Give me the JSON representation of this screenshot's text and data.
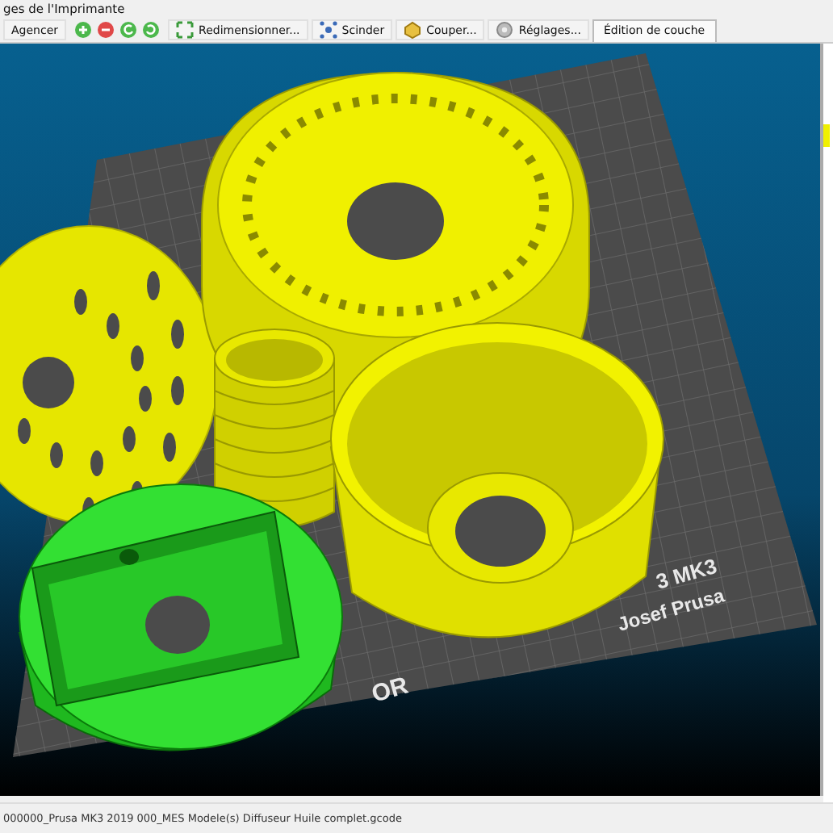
{
  "window": {
    "title": "ges de l'Imprimante"
  },
  "toolbar": {
    "buttons": [
      {
        "label": "Agencer",
        "kind": "plain"
      },
      {
        "label": "Redimensionner...",
        "kind": "scale"
      },
      {
        "label": "Scinder",
        "kind": "split"
      },
      {
        "label": "Couper...",
        "kind": "cut"
      },
      {
        "label": "Réglages...",
        "kind": "settings"
      }
    ],
    "tab": {
      "label": "Édition de couche"
    }
  },
  "viewport": {
    "bed_labels": [
      "3 MK3",
      "Josef Prusa",
      "OR"
    ]
  },
  "status_bar": {
    "text": "000000_Prusa MK3 2019 000_MES Modele(s) Diffuseur Huile complet.gcode"
  }
}
